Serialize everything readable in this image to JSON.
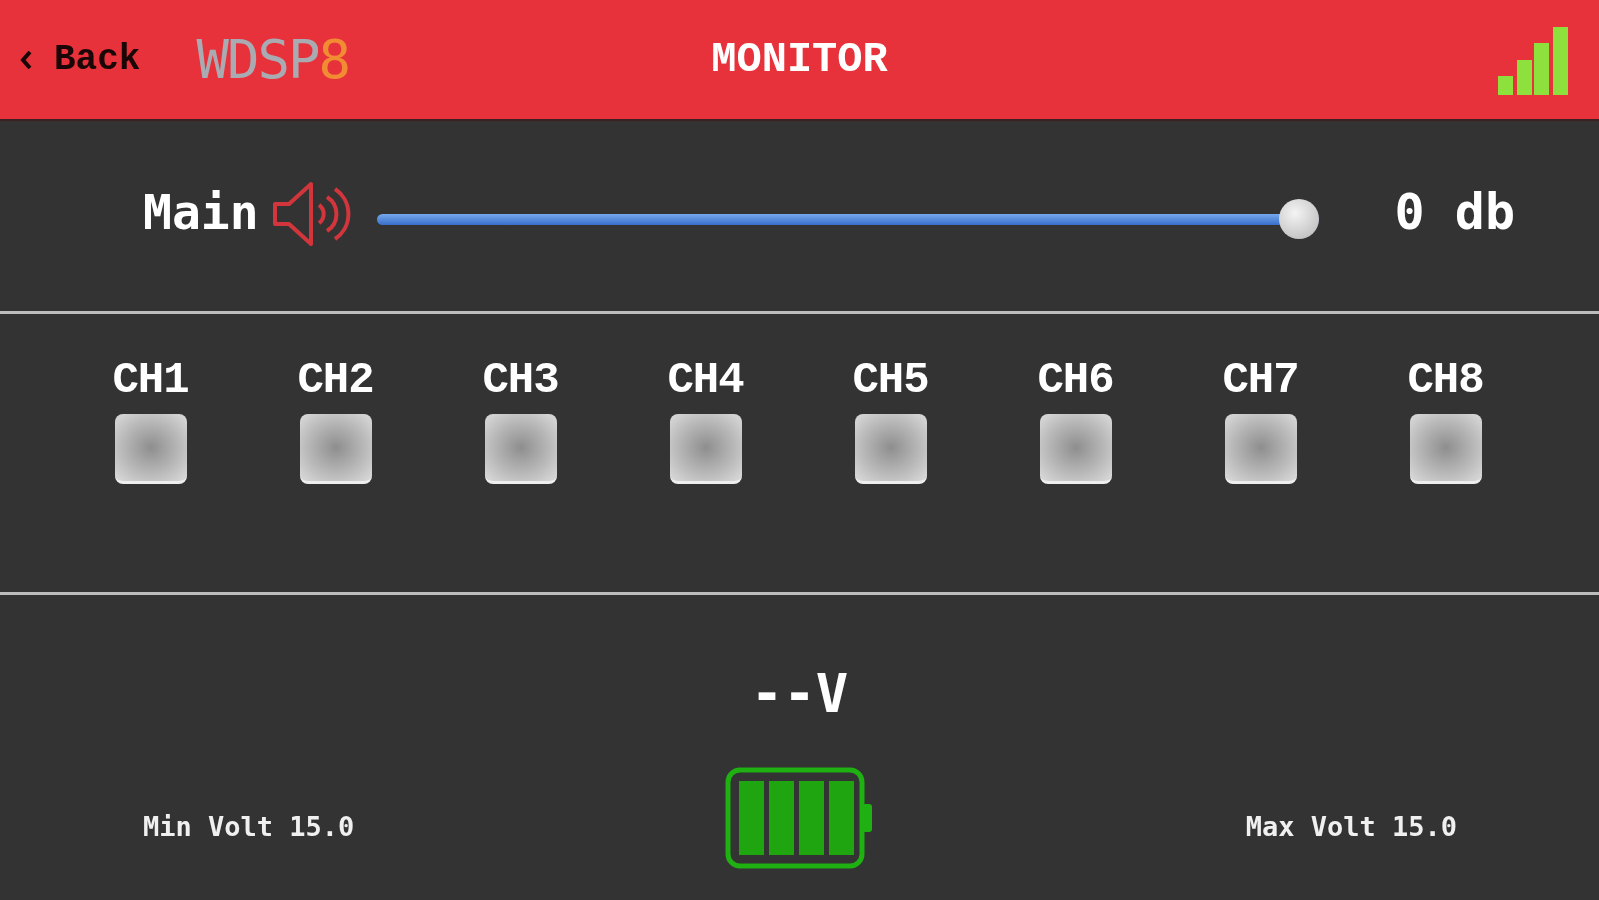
{
  "header": {
    "back": {
      "label": "Back"
    },
    "logo": {
      "text": "WDSP",
      "accent": "8"
    },
    "title": "MONITOR"
  },
  "main": {
    "label": "Main",
    "level": 1,
    "reading": "0 db"
  },
  "channels": [
    {
      "label": "CH1",
      "checked": false
    },
    {
      "label": "CH2",
      "checked": false
    },
    {
      "label": "CH3",
      "checked": false
    },
    {
      "label": "CH4",
      "checked": false
    },
    {
      "label": "CH5",
      "checked": false
    },
    {
      "label": "CH6",
      "checked": false
    },
    {
      "label": "CH7",
      "checked": false
    },
    {
      "label": "CH8",
      "checked": false
    }
  ],
  "voltage": {
    "reading": "--V",
    "min": "Min Volt 15.0",
    "max": "Max Volt 15.0"
  }
}
